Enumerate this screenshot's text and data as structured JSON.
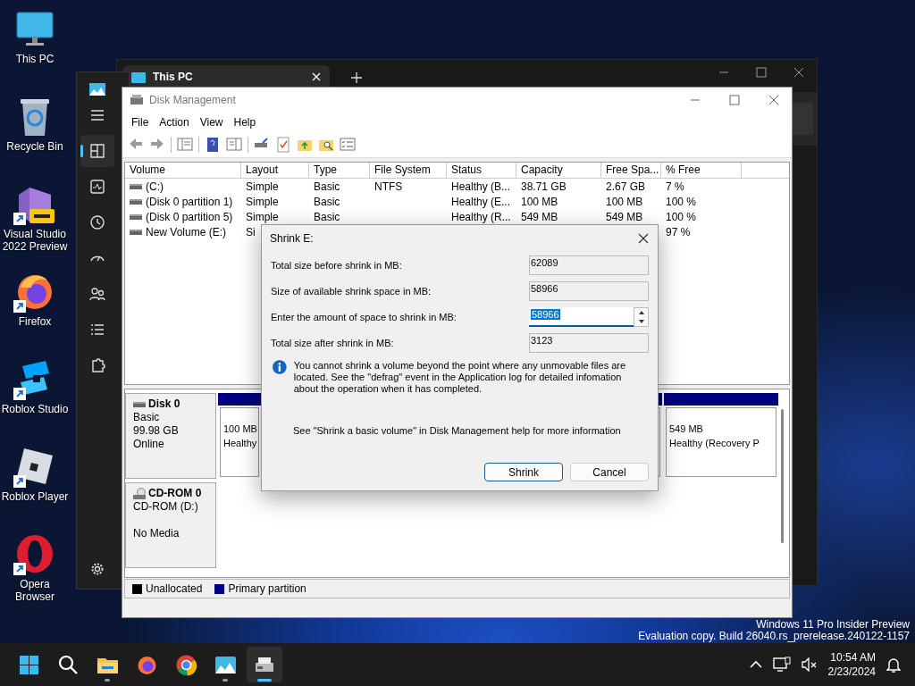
{
  "desktop_icons": [
    {
      "label": "This PC",
      "kind": "pc",
      "shortcut": false
    },
    {
      "label": "Recycle Bin",
      "kind": "bin",
      "shortcut": false
    },
    {
      "label": "Visual Studio 2022 Preview",
      "kind": "vs",
      "shortcut": true
    },
    {
      "label": "Firefox",
      "kind": "firefox",
      "shortcut": true
    },
    {
      "label": "Roblox Studio",
      "kind": "robloxstudio",
      "shortcut": true
    },
    {
      "label": "Roblox Player",
      "kind": "roblox",
      "shortcut": true
    },
    {
      "label": "Opera Browser",
      "kind": "opera",
      "shortcut": true
    }
  ],
  "task_manager": {
    "nav": [
      {
        "kind": "menu",
        "selected": false
      },
      {
        "kind": "processes",
        "selected": true
      },
      {
        "kind": "performance",
        "selected": false
      },
      {
        "kind": "history",
        "selected": false
      },
      {
        "kind": "startup",
        "selected": false
      },
      {
        "kind": "users",
        "selected": false
      },
      {
        "kind": "details",
        "selected": false
      },
      {
        "kind": "services",
        "selected": false
      }
    ]
  },
  "explorer_window": {
    "tab": "This PC"
  },
  "disk_management": {
    "title": "Disk Management",
    "menu": [
      "File",
      "Action",
      "View",
      "Help"
    ],
    "table": {
      "columns": [
        "Volume",
        "Layout",
        "Type",
        "File System",
        "Status",
        "Capacity",
        "Free Spa...",
        "% Free"
      ],
      "rows": [
        {
          "cells": [
            "(C:)",
            "Simple",
            "Basic",
            "NTFS",
            "Healthy (B...",
            "38.71 GB",
            "2.67 GB",
            "7 %"
          ]
        },
        {
          "cells": [
            "(Disk 0 partition 1)",
            "Simple",
            "Basic",
            null,
            "Healthy (E...",
            "100 MB",
            "100 MB",
            "100 %"
          ]
        },
        {
          "cells": [
            "(Disk 0 partition 5)",
            "Simple",
            "Basic",
            null,
            "Healthy (R...",
            "549 MB",
            "549 MB",
            "100 %"
          ]
        },
        {
          "cells": [
            "New Volume (E:)",
            "Si",
            null,
            null,
            null,
            null,
            null,
            "97 %"
          ]
        }
      ]
    },
    "disks": [
      {
        "name": "Disk 0",
        "kind": "disk",
        "type": "Basic",
        "size": "99.98 GB",
        "status": "Online",
        "partitions": [
          {
            "kind": "primary",
            "size": "100 MB",
            "status": "Healthy"
          },
          {
            "kind": "primary"
          },
          {
            "kind": "primary",
            "size": "549 MB",
            "status": "Healthy (Recovery P"
          }
        ]
      },
      {
        "name": "CD-ROM 0",
        "kind": "cdrom",
        "type": "CD-ROM (D:)",
        "status": "No Media"
      }
    ],
    "legend": [
      {
        "label": "Unallocated",
        "color": "#000000"
      },
      {
        "label": "Primary partition",
        "color": "#000080"
      }
    ]
  },
  "dialog": {
    "title": "Shrink E:",
    "fields": [
      {
        "label": "Total size before shrink in MB:",
        "value": "62089",
        "kind": "readonly"
      },
      {
        "label": "Size of available shrink space in MB:",
        "value": "58966",
        "kind": "readonly"
      },
      {
        "label": "Enter the amount of space to shrink in MB:",
        "value": "58966",
        "kind": "spin",
        "selected": true
      },
      {
        "label": "Total size after shrink in MB:",
        "value": "3123",
        "kind": "readonly"
      }
    ],
    "info": "You cannot shrink a volume beyond the point where any unmovable files are located. See the \"defrag\" event in the Application log for detailed infomation about the operation when it has completed.",
    "help": "See \"Shrink a basic volume\" in Disk Management help for more information",
    "buttons": [
      {
        "label": "Shrink",
        "default": true
      },
      {
        "label": "Cancel",
        "default": false
      }
    ]
  },
  "os_notice": [
    "Windows 11 Pro Insider Preview",
    "Evaluation copy. Build 26040.rs_prerelease.240122-1157"
  ],
  "taskbar": {
    "buttons": [
      {
        "kind": "start",
        "running": false,
        "selected": false
      },
      {
        "kind": "search",
        "running": false,
        "selected": false
      },
      {
        "kind": "explorer",
        "running": true,
        "selected": false
      },
      {
        "kind": "firefox",
        "running": false,
        "selected": false
      },
      {
        "kind": "chrome",
        "running": false,
        "selected": false
      },
      {
        "kind": "taskmgr",
        "running": true,
        "selected": false
      },
      {
        "kind": "diskmgmt",
        "running": true,
        "selected": true
      }
    ],
    "time": "10:54 AM",
    "date": "2/23/2024"
  }
}
